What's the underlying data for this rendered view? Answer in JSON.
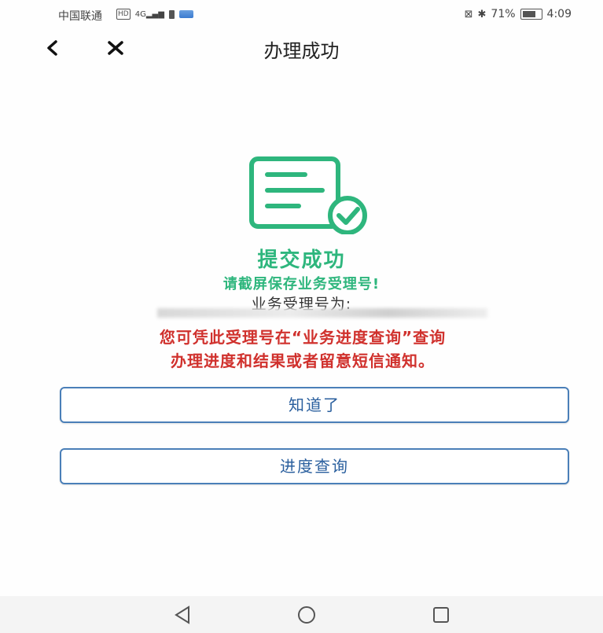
{
  "status_bar": {
    "carrier": "中国联通",
    "hd_badge": "HD",
    "signal_label": "4G",
    "battery_percent": "71%",
    "time": "4:09"
  },
  "nav": {
    "title": "办理成功"
  },
  "content": {
    "success_title": "提交成功",
    "screenshot_tip": "请截屏保存业务受理号!",
    "acceptance_label": "业务受理号为:",
    "notice_line1": "您可凭此受理号在“业务进度查询”查询",
    "notice_line2": "办理进度和结果或者留意短信通知。"
  },
  "buttons": {
    "ok_label": "知道了",
    "progress_label": "进度查询"
  },
  "colors": {
    "accent_green": "#2eb67d",
    "notice_red": "#d0312d",
    "button_blue": "#2a5f9e"
  },
  "icons": {
    "document_check": "document-check-icon",
    "back": "back-arrow-icon",
    "close": "close-icon",
    "sys_back": "triangle-back-icon",
    "sys_home": "circle-home-icon",
    "sys_recent": "square-recent-icon"
  }
}
